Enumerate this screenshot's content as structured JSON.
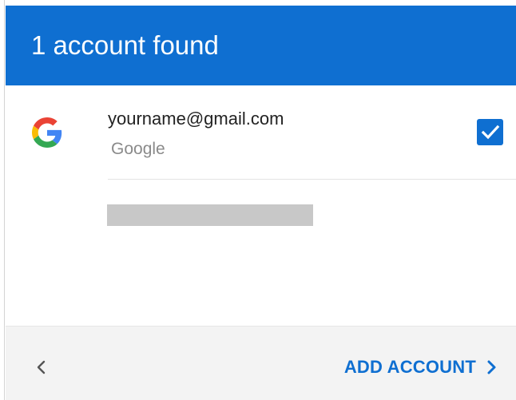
{
  "header": {
    "title": "1 account found"
  },
  "account": {
    "email": "yourname@gmail.com",
    "provider": "Google",
    "icon": "google-icon",
    "selected": true
  },
  "footer": {
    "back_icon": "chevron-left-icon",
    "add_account_label": "ADD ACCOUNT",
    "add_account_icon": "chevron-right-icon"
  },
  "colors": {
    "accent": "#0f6fd1",
    "footer_bg": "#f3f3f3",
    "secondary_text": "#8a8a8a",
    "placeholder": "#c8c8c8"
  }
}
